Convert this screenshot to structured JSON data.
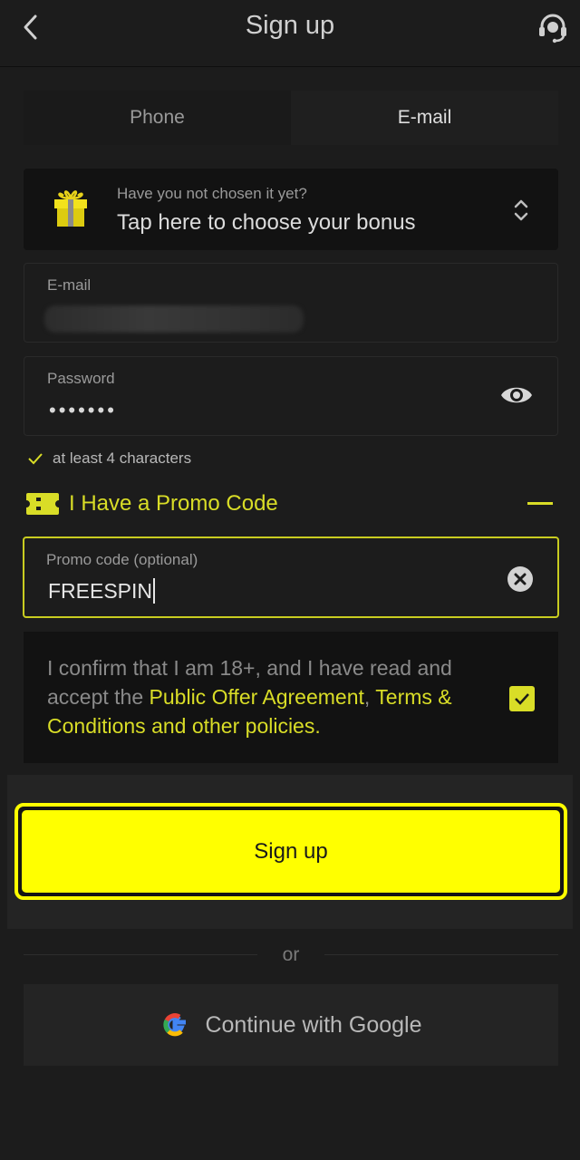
{
  "header": {
    "title": "Sign up"
  },
  "tabs": [
    {
      "label": "Phone",
      "active": false
    },
    {
      "label": "E-mail",
      "active": true
    }
  ],
  "bonus": {
    "hint": "Have you not chosen it yet?",
    "main": "Tap here to choose your bonus"
  },
  "email": {
    "label": "E-mail",
    "value": ""
  },
  "password": {
    "label": "Password",
    "value": "•••••••"
  },
  "password_rules": [
    {
      "text": "at least 4 characters",
      "met": true
    }
  ],
  "promo": {
    "title": "I Have a Promo Code",
    "label": "Promo code (optional)",
    "value": "FREESPIN"
  },
  "consent": {
    "text_prefix": "I confirm that I am 18+, and I have read and accept the ",
    "link_offer": "Public Offer Agreement",
    "separator": ",",
    "link_terms": "Terms & Conditions and other policies",
    "suffix": ".",
    "checked": true
  },
  "signup_button": {
    "label": "Sign up"
  },
  "divider": {
    "text": "or"
  },
  "google_button": {
    "label": "Continue with Google"
  },
  "colors": {
    "accent": "#ffff00",
    "accent_text": "#d9dd27",
    "background": "#1c1c1c",
    "panel": "#121212"
  },
  "icons": {
    "back": "chevron-left-icon",
    "support": "headset-icon",
    "gift": "gift-icon",
    "selector": "chevron-updown-icon",
    "eye": "eye-icon",
    "rule_check": "check-icon",
    "ticket": "ticket-icon",
    "collapse": "minus-icon",
    "clear": "clear-icon",
    "consent_check": "checkbox-check-icon",
    "google": "google-icon"
  }
}
